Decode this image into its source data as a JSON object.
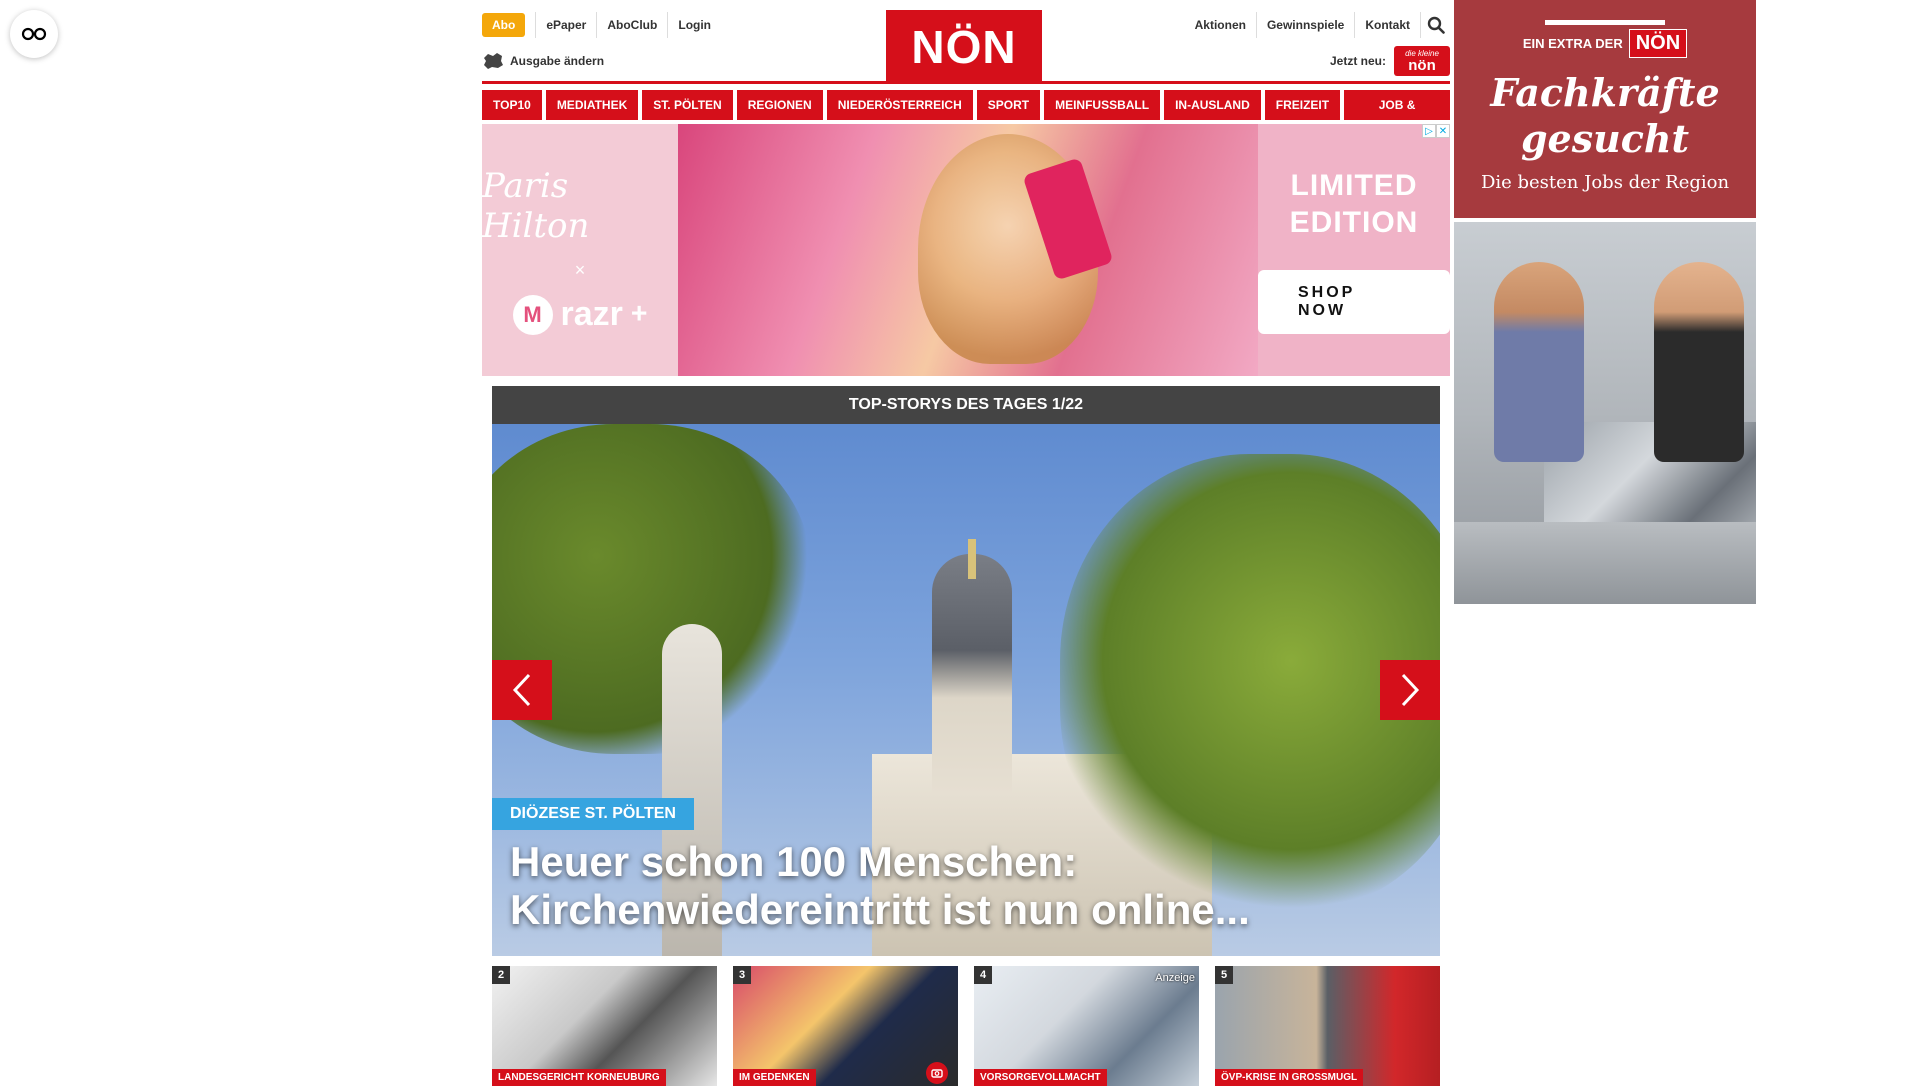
{
  "top_nav": {
    "abo": "Abo",
    "links": [
      "ePaper",
      "AboClub",
      "Login"
    ]
  },
  "ausgabe": {
    "label": "Ausgabe ändern"
  },
  "logo": "NÖN",
  "right_nav": {
    "links": [
      "Aktionen",
      "Gewinnspiele",
      "Kontakt"
    ]
  },
  "jetzt_neu": {
    "label": "Jetzt neu:",
    "logo_small": "die kleine",
    "logo_text": "nön"
  },
  "categories": [
    "TOP10",
    "MEDIATHEK",
    "ST. PÖLTEN",
    "REGIONEN",
    "NIEDERÖSTERREICH",
    "SPORT",
    "MEINFUSSBALL",
    "IN-AUSLAND",
    "FREIZEIT",
    "JOB & KARRIERE"
  ],
  "ad_banner": {
    "signature": "Paris Hilton",
    "x": "×",
    "brand": "razr",
    "brand_sup": "+",
    "headline": "LIMITED EDITION",
    "cta": "SHOP NOW"
  },
  "top_stories": {
    "heading": "TOP-STORYS DES TAGES 1/22",
    "tag": "DIÖZESE ST. PÖLTEN",
    "title": "Heuer schon 100 Menschen: Kirchenwiedereintritt ist nun online...",
    "thumbnails": [
      {
        "num": "2",
        "label": "LANDESGERICHT KORNEUBURG"
      },
      {
        "num": "3",
        "label": "IM GEDENKEN"
      },
      {
        "num": "4",
        "label": "VORSORGEVOLLMACHT",
        "badge": "Anzeige"
      },
      {
        "num": "5",
        "label": "ÖVP-KRISE IN GROSSMUGL"
      }
    ]
  },
  "side_ad": {
    "extra": "EIN EXTRA DER",
    "logo": "NÖN",
    "headline": "Fachkräfte gesucht",
    "sub": "Die besten Jobs der Region"
  }
}
